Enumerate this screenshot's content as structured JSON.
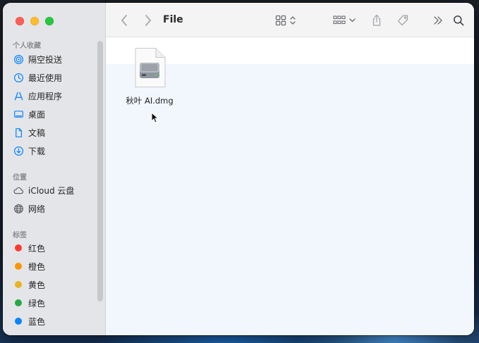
{
  "window": {
    "title": "File"
  },
  "sidebar": {
    "favorites_heading": "个人收藏",
    "favorites": [
      {
        "label": "隔空投送",
        "icon": "airdrop-icon"
      },
      {
        "label": "最近使用",
        "icon": "clock-icon"
      },
      {
        "label": "应用程序",
        "icon": "applications-icon"
      },
      {
        "label": "桌面",
        "icon": "desktop-icon"
      },
      {
        "label": "文稿",
        "icon": "document-icon"
      },
      {
        "label": "下载",
        "icon": "download-icon"
      }
    ],
    "locations_heading": "位置",
    "locations": [
      {
        "label": "iCloud 云盘",
        "icon": "icloud-icon"
      },
      {
        "label": "网络",
        "icon": "network-icon"
      }
    ],
    "tags_heading": "标签",
    "tags": [
      {
        "label": "红色",
        "color": "#ff3b30"
      },
      {
        "label": "橙色",
        "color": "#ff9500"
      },
      {
        "label": "黄色",
        "color": "#e8b321"
      },
      {
        "label": "绿色",
        "color": "#28a745"
      },
      {
        "label": "蓝色",
        "color": "#0a84ff"
      }
    ]
  },
  "files": [
    {
      "name": "秋叶 AI.dmg",
      "icon": "disk-image-icon"
    }
  ],
  "colors": {
    "accent": "#0a84ff"
  }
}
